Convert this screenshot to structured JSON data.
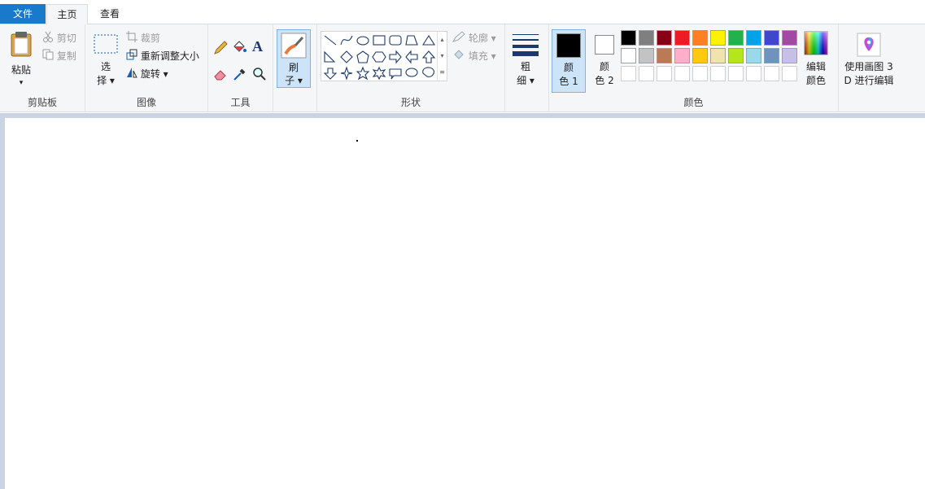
{
  "tabs": {
    "file": "文件",
    "home": "主页",
    "view": "查看"
  },
  "clipboard": {
    "paste": "粘贴",
    "cut": "剪切",
    "copy": "复制",
    "label": "剪贴板"
  },
  "image": {
    "select_1": "选",
    "select_2": "择",
    "crop": "裁剪",
    "resize": "重新调整大小",
    "rotate": "旋转",
    "label": "图像"
  },
  "tools": {
    "label": "工具"
  },
  "brushes": {
    "line1": "刷",
    "line2": "子"
  },
  "shapes": {
    "outline": "轮廓",
    "fill": "填充",
    "label": "形状"
  },
  "size": {
    "line1": "粗",
    "line2": "细"
  },
  "colors": {
    "color1_line1": "颜",
    "color1_line2": "色 1",
    "color2_line1": "颜",
    "color2_line2": "色 2",
    "edit_line1": "编辑",
    "edit_line2": "颜色",
    "label": "颜色",
    "color1": "#000000",
    "color2": "#ffffff",
    "palette_row1": [
      "#000000",
      "#7f7f7f",
      "#880015",
      "#ed1c24",
      "#ff7f27",
      "#fff200",
      "#22b14c",
      "#00a2e8",
      "#3f48cc",
      "#a349a4"
    ],
    "palette_row2": [
      "#ffffff",
      "#c3c3c3",
      "#b97a57",
      "#ffaec9",
      "#ffc90e",
      "#efe4b0",
      "#b5e61d",
      "#99d9ea",
      "#7092be",
      "#c8bfe7"
    ],
    "palette_row3": [
      "#ffffff",
      "#ffffff",
      "#ffffff",
      "#ffffff",
      "#ffffff",
      "#ffffff",
      "#ffffff",
      "#ffffff",
      "#ffffff",
      "#ffffff"
    ]
  },
  "paint3d": {
    "line1": "使用画图 3",
    "line2": "D 进行编辑"
  },
  "accent": "#1979ca"
}
